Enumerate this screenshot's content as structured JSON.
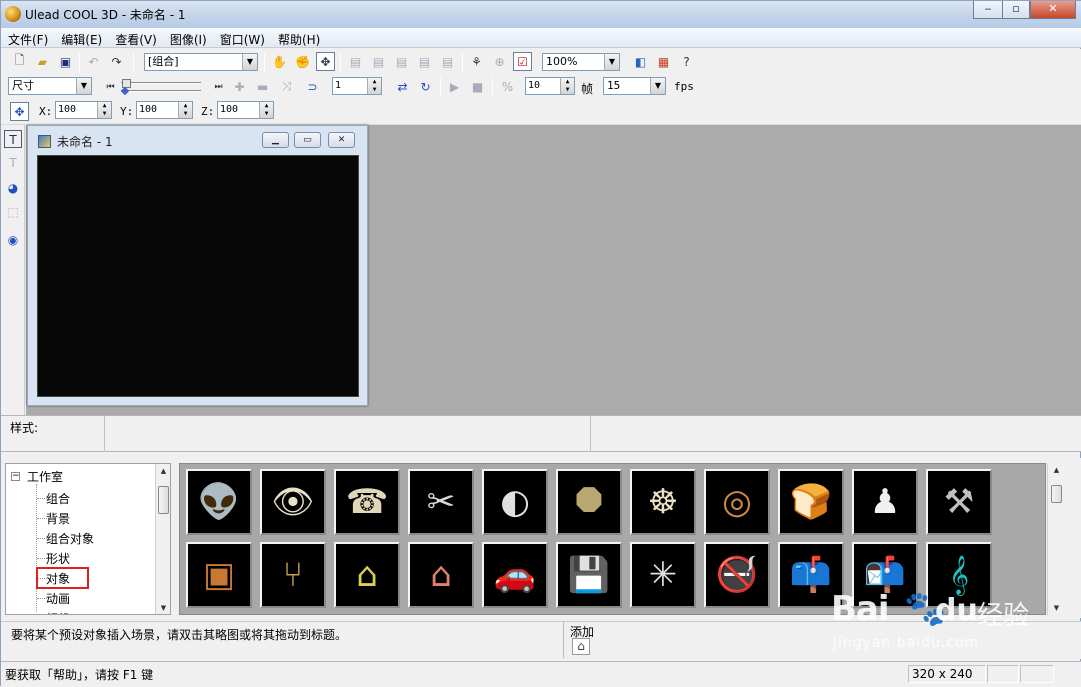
{
  "window": {
    "title": "Ulead COOL 3D - 未命名 - 1",
    "minimize": "‒",
    "maximize": "▫",
    "close": "✕"
  },
  "menu": [
    "文件(F)",
    "编辑(E)",
    "查看(V)",
    "图像(I)",
    "窗口(W)",
    "帮助(H)"
  ],
  "toolbar1": {
    "group_select": "[组合]",
    "zoom": "100%"
  },
  "toolbar2": {
    "property_select": "尺寸",
    "frame_value": "1",
    "play_count": "10",
    "frame_label": "帧",
    "fps_value": "15",
    "fps_label": "fps"
  },
  "toolbar3": {
    "x_label": "X:",
    "x_value": "100",
    "y_label": "Y:",
    "y_value": "100",
    "z_label": "Z:",
    "z_value": "100"
  },
  "document": {
    "title": "未命名 - 1"
  },
  "style_bar": {
    "label": "样式:"
  },
  "tree": {
    "root": "工作室",
    "items": [
      "组合",
      "背景",
      "组合对象",
      "形状",
      "对象",
      "动画",
      "相机"
    ],
    "selected": "对象"
  },
  "thumbnails": {
    "row1": [
      {
        "name": "alien-head",
        "glyph": "👽"
      },
      {
        "name": "eye",
        "glyph": "👁"
      },
      {
        "name": "telephone",
        "glyph": "☎"
      },
      {
        "name": "scissors",
        "glyph": "✂"
      },
      {
        "name": "ring",
        "glyph": "◐"
      },
      {
        "name": "octagon-sign",
        "glyph": "⯃"
      },
      {
        "name": "steering-wheel",
        "glyph": "☸"
      },
      {
        "name": "donut",
        "glyph": "◎"
      },
      {
        "name": "bread",
        "glyph": "🍞"
      },
      {
        "name": "bowling-pin",
        "glyph": "♟"
      },
      {
        "name": "hammer",
        "glyph": "⚒"
      }
    ],
    "row2": [
      {
        "name": "box-crate",
        "glyph": "▣"
      },
      {
        "name": "chair",
        "glyph": "⑂"
      },
      {
        "name": "dog-house",
        "glyph": "⌂"
      },
      {
        "name": "barn",
        "glyph": "⌂"
      },
      {
        "name": "car",
        "glyph": "🚗"
      },
      {
        "name": "floppy-disk",
        "glyph": "💾"
      },
      {
        "name": "spider-web",
        "glyph": "✳"
      },
      {
        "name": "no-smoking",
        "glyph": "🚭"
      },
      {
        "name": "mailbox",
        "glyph": "📫"
      },
      {
        "name": "mailbox-open",
        "glyph": "📬"
      },
      {
        "name": "treble-clef",
        "glyph": "𝄞"
      }
    ]
  },
  "hint": {
    "text": "要将某个预设对象插入场景，请双击其略图或将其拖动到标题。",
    "add_label": "添加"
  },
  "status": {
    "help": "要获取「帮助」，请按 F1 键",
    "size": "320 x 240"
  },
  "watermark": {
    "brand_left": "Bai",
    "brand_right": "du",
    "brand_cn": "经验",
    "url": "jingyan.baidu.com"
  },
  "colors": {
    "selection_box": "#e02020",
    "canvas": "#070707",
    "workspace": "#ababab"
  }
}
